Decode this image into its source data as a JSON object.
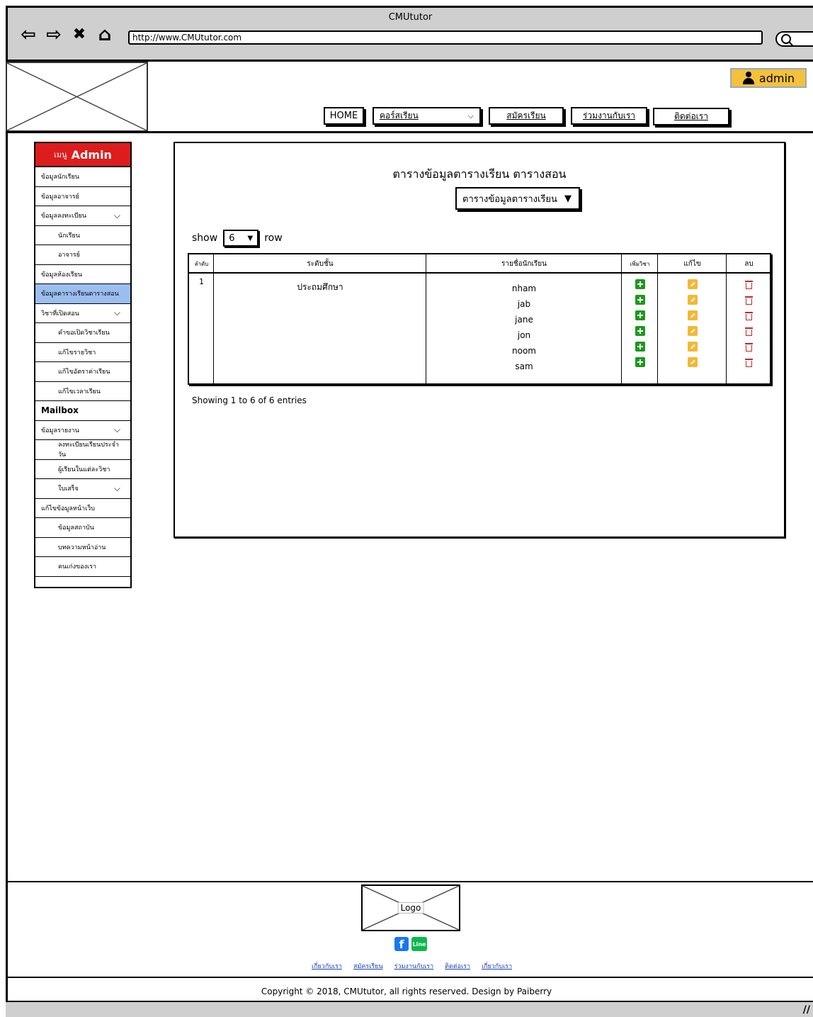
{
  "browser": {
    "title": "CMUtutor",
    "url": "http://www.CMUtutor.com",
    "icons": [
      "back-arrow-icon",
      "forward-arrow-icon",
      "close-icon",
      "home-icon",
      "search-icon"
    ]
  },
  "header": {
    "admin_label": "admin",
    "nav": {
      "home": "HOME",
      "courses": "คอร์สเรียน",
      "register": "สมัครเรียน",
      "partner": "ร่วมงานกับเรา",
      "contact": "ติดต่อเรา"
    }
  },
  "sidebar": {
    "head_small": "เมนู",
    "head_big": "Admin",
    "items": [
      {
        "label": "ข้อมูลนักเรียน",
        "sub": false,
        "chev": false,
        "active": false
      },
      {
        "label": "ข้อมูลอาจารย์",
        "sub": false,
        "chev": false,
        "active": false
      },
      {
        "label": "ข้อมูลลงทะเบียน",
        "sub": false,
        "chev": true,
        "active": false
      },
      {
        "label": "นักเรียน",
        "sub": true,
        "chev": false,
        "active": false
      },
      {
        "label": "อาจารย์",
        "sub": true,
        "chev": false,
        "active": false
      },
      {
        "label": "ข้อมูลห้องเรียน",
        "sub": false,
        "chev": false,
        "active": false
      },
      {
        "label": "ข้อมูลตารางเรียนตารางสอน",
        "sub": false,
        "chev": false,
        "active": true
      },
      {
        "label": "วิชาที่เปิดสอน",
        "sub": false,
        "chev": true,
        "active": false
      },
      {
        "label": "คำขอเปิดวิชาเรียน",
        "sub": true,
        "chev": false,
        "active": false
      },
      {
        "label": "แก้ไขรายวิชา",
        "sub": true,
        "chev": false,
        "active": false
      },
      {
        "label": "แก้ไขอัตราค่าเรียน",
        "sub": true,
        "chev": false,
        "active": false
      },
      {
        "label": "แก้ไขเวลาเรียน",
        "sub": true,
        "chev": false,
        "active": false
      },
      {
        "label": "Mailbox",
        "sub": false,
        "chev": false,
        "active": false,
        "mail": true
      },
      {
        "label": "ข้อมูลรายงาน",
        "sub": false,
        "chev": true,
        "active": false
      },
      {
        "label": "ลงทะเบียนเรียนประจำวัน",
        "sub": true,
        "chev": false,
        "active": false
      },
      {
        "label": "ผู้เรียนในแต่ละวิชา",
        "sub": true,
        "chev": false,
        "active": false
      },
      {
        "label": "ใบเสร็จ",
        "sub": true,
        "chev": true,
        "active": false
      },
      {
        "label": "แก้ไขข้อมูลหน้าเว็บ",
        "sub": false,
        "chev": false,
        "active": false
      },
      {
        "label": "ข้อมูลสถาบัน",
        "sub": true,
        "chev": false,
        "active": false
      },
      {
        "label": "บทความหน้าอ่าน",
        "sub": true,
        "chev": false,
        "active": false
      },
      {
        "label": "คนเก่งของเรา",
        "sub": true,
        "chev": false,
        "active": false
      }
    ]
  },
  "main": {
    "title": "ตารางข้อมูลตารางเรียน ตารางสอน",
    "table_select": "ตารางข้อมูลตารางเรียน",
    "show_label": "show",
    "show_value": "6",
    "row_label": "row",
    "columns": {
      "no": "ลำดับ",
      "level": "ระดับชั้น",
      "students": "รายชื่อนักเรียน",
      "add": "เพิ่มวิชา",
      "edit": "แก้ไข",
      "delete": "ลบ"
    },
    "row": {
      "no": "1",
      "level": "ประถมศึกษา",
      "students": [
        "nham",
        "jab",
        "jane",
        "jon",
        "noom",
        "sam"
      ]
    },
    "entries": "Showing 1 to 6 of 6 entries"
  },
  "footer": {
    "logo_label": "Logo",
    "social": {
      "facebook": "f",
      "line": "Line"
    },
    "links": [
      "เกี่ยวกับเรา",
      "สมัครเรียน",
      "ร่วมงานกับเรา",
      "ติดต่อเรา",
      "เกี่ยวกับเรา"
    ],
    "copyright": "Copyright © 2018, CMUtutor, all rights reserved. Design by Paiberry"
  }
}
